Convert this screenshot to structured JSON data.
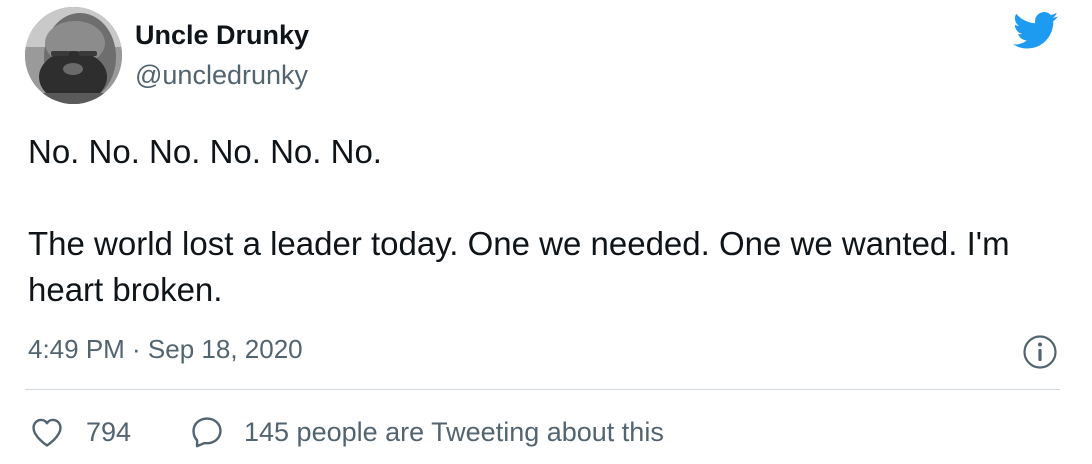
{
  "tweet": {
    "author": {
      "display_name": "Uncle Drunky",
      "handle": "@uncledrunky",
      "avatar_icon": "avatar-photo"
    },
    "text_lines": [
      "No. No. No. No. No. No.",
      "The world lost a leader today. One we needed. One we wanted. I'm heart broken."
    ],
    "timestamp": "4:49 PM · Sep 18, 2020",
    "actions": {
      "like_count": "794",
      "reply_text": "145 people are Tweeting about this"
    },
    "icons": {
      "brand": "twitter-bird-icon",
      "info": "info-icon",
      "like": "heart-icon",
      "reply": "speech-bubble-icon"
    },
    "colors": {
      "brand_blue": "#1d9bf0",
      "secondary_text": "#536471",
      "primary_text": "#0f1419",
      "divider": "#cfd9de"
    }
  }
}
